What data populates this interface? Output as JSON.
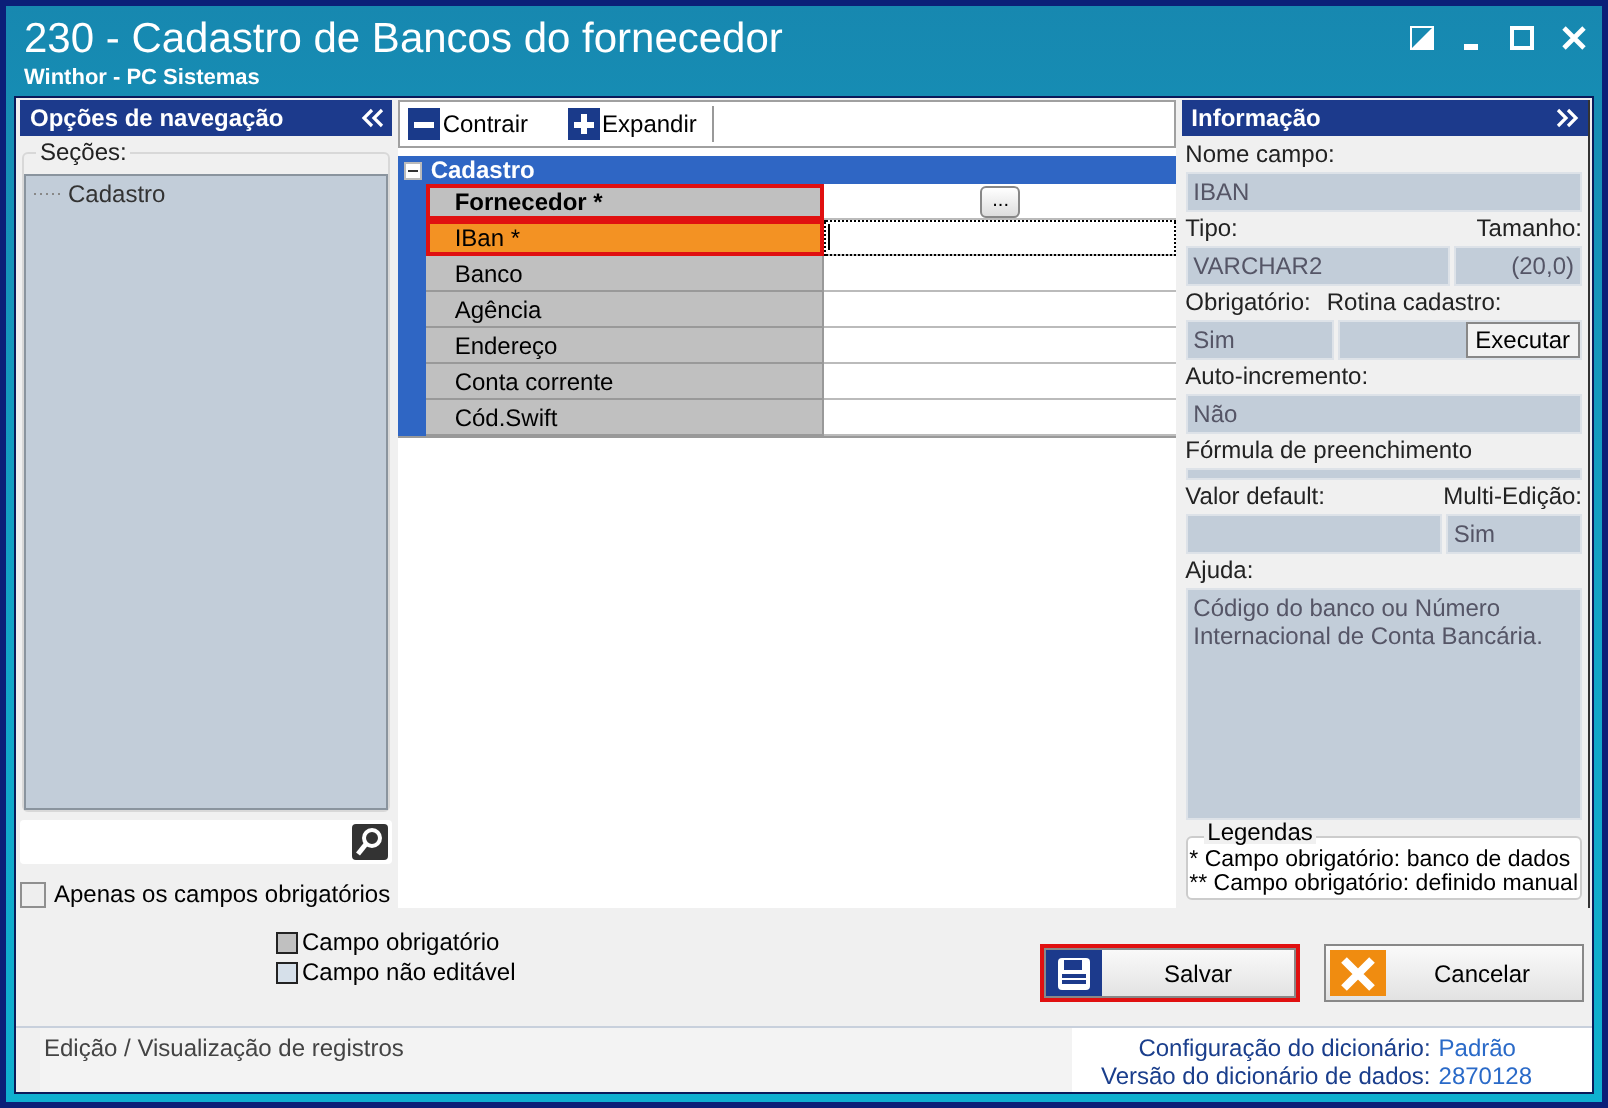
{
  "window": {
    "title": "230 - Cadastro de Bancos do fornecedor",
    "subtitle": "Winthor - PC Sistemas"
  },
  "nav": {
    "title": "Opções de navegação",
    "sections_label": "Seções:",
    "tree": [
      {
        "label": "Cadastro",
        "selected": false
      }
    ],
    "only_required": {
      "label": "Apenas os campos obrigatórios",
      "checked": false
    }
  },
  "toolbar": [
    {
      "label": "Contrair",
      "kind": "collapse"
    },
    {
      "label": "Expandir",
      "kind": "expand"
    }
  ],
  "grid": {
    "group": {
      "label": "Cadastro",
      "expanded": true
    },
    "rows": [
      {
        "label": "Fornecedor *",
        "kind": "lookup",
        "lookup": "...",
        "bold": true,
        "selected": false,
        "highlighted": true
      },
      {
        "label": "IBan *",
        "kind": "text",
        "bold": false,
        "selected": true,
        "highlighted": true
      },
      {
        "label": "Banco",
        "kind": "text",
        "bold": false,
        "selected": false,
        "highlighted": false
      },
      {
        "label": "Agência",
        "kind": "text",
        "bold": false,
        "selected": false,
        "highlighted": false
      },
      {
        "label": "Endereço",
        "kind": "text",
        "bold": false,
        "selected": false,
        "highlighted": false
      },
      {
        "label": "Conta corrente",
        "kind": "text",
        "bold": false,
        "selected": false,
        "highlighted": false
      },
      {
        "label": "Cód.Swift",
        "kind": "text",
        "bold": false,
        "selected": false,
        "highlighted": false
      }
    ]
  },
  "info": {
    "title": "Informação",
    "nome_campo": {
      "label": "Nome campo:",
      "value": "IBAN"
    },
    "tipo": {
      "label": "Tipo:",
      "value": "VARCHAR2"
    },
    "tamanho": {
      "label": "Tamanho:",
      "value": "(20,0)"
    },
    "obrigatorio": {
      "label": "Obrigatório:",
      "value": "Sim"
    },
    "rotina_cadastro": {
      "label": "Rotina cadastro:",
      "button": "Executar"
    },
    "auto_incremento": {
      "label": "Auto-incremento:",
      "value": "Não"
    },
    "formula": {
      "label": "Fórmula de preenchimento"
    },
    "valor_default": {
      "label": "Valor default:"
    },
    "multi_edicao": {
      "label": "Multi-Edição:",
      "value": "Sim"
    },
    "ajuda": {
      "label": "Ajuda:",
      "value": "Código do banco ou Número Internacional de Conta Bancária."
    },
    "legendas": {
      "title": "Legendas",
      "lines": [
        "* Campo obrigatório: banco de dados",
        "** Campo obrigatório: definido manual"
      ]
    }
  },
  "legend": [
    {
      "label": "Campo obrigatório",
      "color": "#c0c0c0"
    },
    {
      "label": "Campo não editável",
      "color": "#d6e0ea"
    }
  ],
  "buttons": [
    {
      "label": "Salvar",
      "kind": "save",
      "highlighted": true
    },
    {
      "label": "Cancelar",
      "kind": "cancel",
      "highlighted": false
    }
  ],
  "status": {
    "text": "Edição / Visualização de registros",
    "config_label": "Configuração do dicionário:",
    "config_value": "Padrão",
    "version_label": "Versão do dicionário de dados:",
    "version_value": "2870128"
  }
}
